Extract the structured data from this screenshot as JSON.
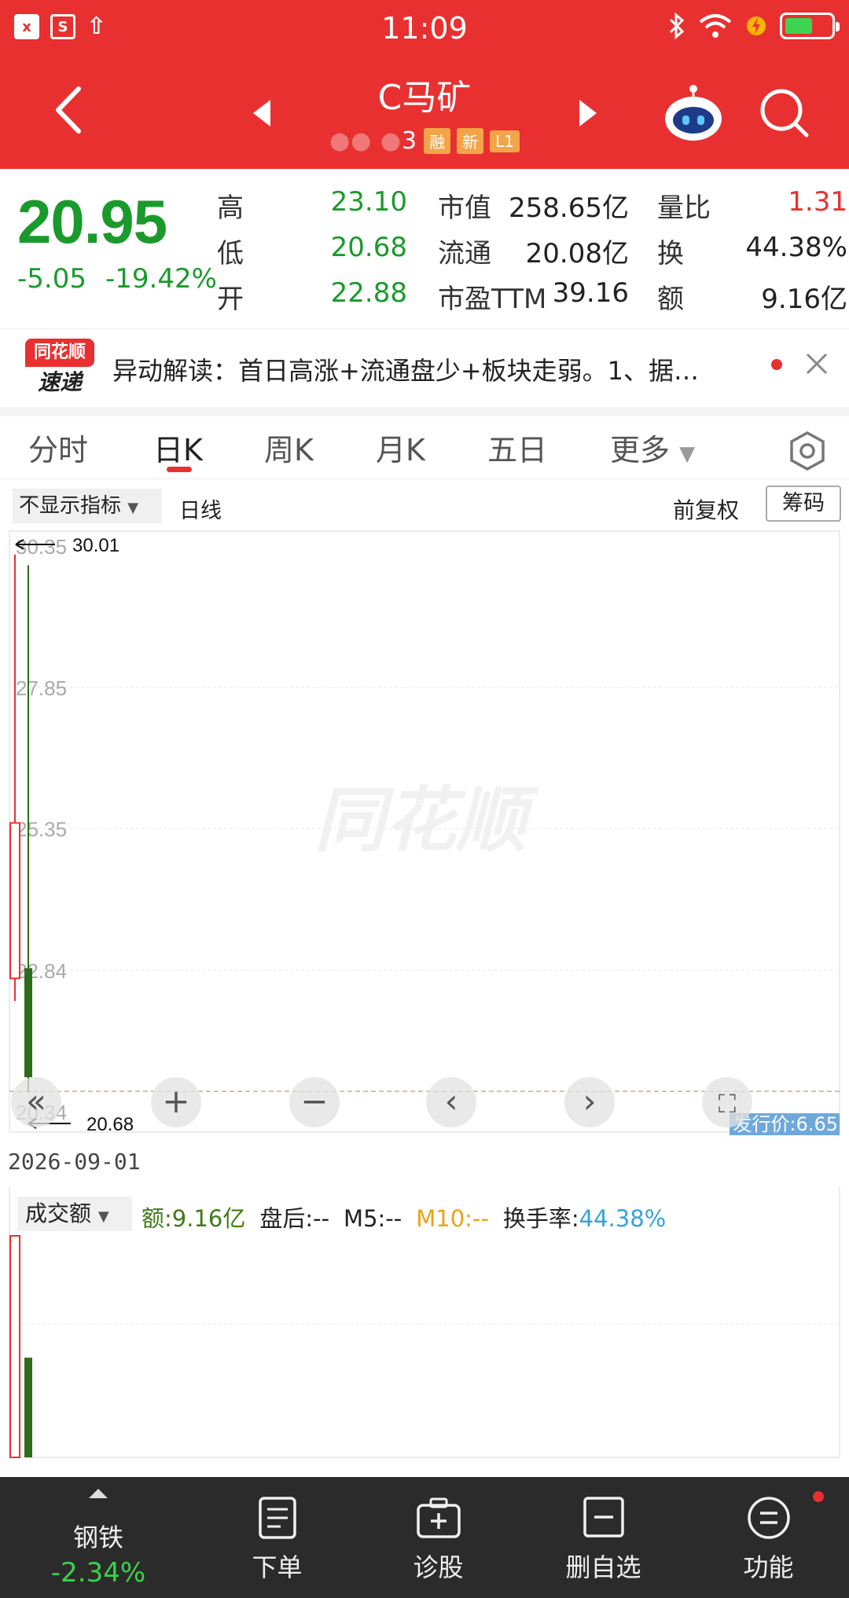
{
  "status_bar": {
    "time": "11:09",
    "left_icon_1": "x",
    "left_icon_2": "S"
  },
  "header": {
    "stock_name": "C马矿",
    "code_suffix": "3",
    "tags": [
      "融",
      "新",
      "L1"
    ]
  },
  "quote": {
    "price": "20.95",
    "change": "-5.05",
    "change_pct": "-19.42%",
    "high_label": "高",
    "high": "23.10",
    "low_label": "低",
    "low": "20.68",
    "open_label": "开",
    "open": "22.88",
    "mktcap_label": "市值",
    "mktcap": "258.65亿",
    "float_label": "流通",
    "float": "20.08亿",
    "pe_label": "市盈TTM",
    "pe": "39.16",
    "vol_ratio_label": "量比",
    "vol_ratio": "1.31",
    "turnover_label": "换",
    "turnover": "44.38%",
    "amount_label": "额",
    "amount": "9.16亿"
  },
  "news": {
    "logo_top": "同花顺",
    "logo_bottom": "速递",
    "text": "异动解读：首日高涨+流通盘少+板块走弱。1、据…"
  },
  "tabs": [
    "分时",
    "日K",
    "周K",
    "月K",
    "五日",
    "更多"
  ],
  "active_tab": "日K",
  "chart_toolbar": {
    "indicator": "不显示指标",
    "period": "日线",
    "adjust": "前复权",
    "chips": "筹码"
  },
  "chart_data": {
    "type": "candlestick",
    "y_ticks": [
      "30.35",
      "27.85",
      "25.35",
      "22.84",
      "20.34"
    ],
    "ylim": [
      20.34,
      30.35
    ],
    "high_marker": "30.01",
    "low_marker": "20.68",
    "watermark": "同花顺",
    "issue_price_label": "发行价:6.65",
    "candles": [
      {
        "date": "2026-09-01",
        "open": 22.88,
        "high": 30.01,
        "low": 20.68,
        "close": 20.95,
        "direction": "down"
      }
    ],
    "ipo_candle": {
      "open": 22.7,
      "high": 30.2,
      "low": 22.3,
      "close": 25.45,
      "direction": "up"
    },
    "selected_date": "2026-09-01"
  },
  "volume": {
    "selector": "成交额",
    "amount": "额:9.16亿",
    "after_hours": "盘后:--",
    "m5": "M5:--",
    "m10": "M10:--",
    "turnover_label": "换手率:",
    "turnover": "44.38%",
    "bars": [
      {
        "label": "ipo",
        "value": 1.0,
        "direction": "up"
      },
      {
        "label": "2026-09-01",
        "value": 0.45,
        "direction": "down"
      }
    ]
  },
  "bottom_bar": {
    "sector_name": "钢铁",
    "sector_change": "-2.34%",
    "items": [
      "下单",
      "诊股",
      "删自选",
      "功能"
    ]
  },
  "colors": {
    "brand_red": "#e93030",
    "down_green": "#1b9a2c",
    "bar_green": "#2e6b1a"
  }
}
